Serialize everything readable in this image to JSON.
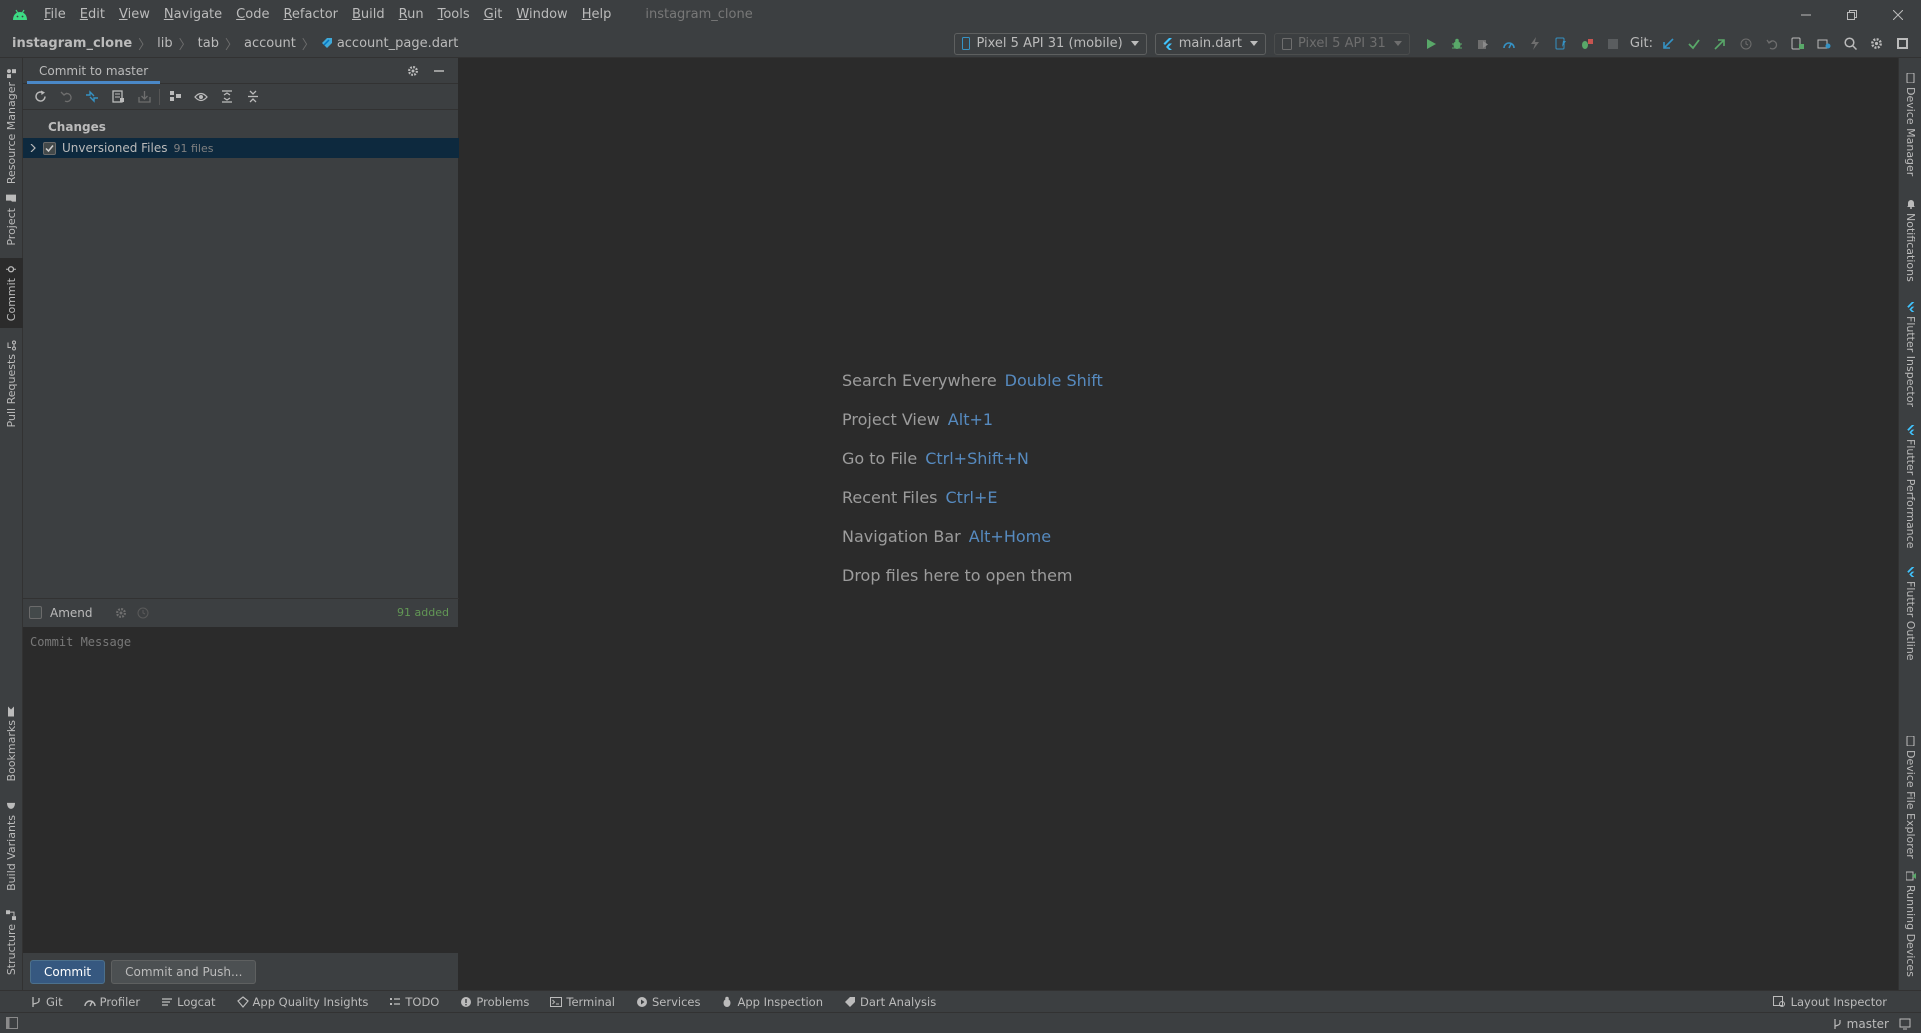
{
  "colors": {
    "background": "#2b2b2b",
    "chrome": "#3c3f41",
    "accent": "#4a88c7",
    "selection": "#0d293e",
    "run_green": "#59a869",
    "git_blue": "#3592c4",
    "added_green": "#629755",
    "shortcut_blue": "#5e9bd9",
    "android_green": "#3ddc84"
  },
  "window": {
    "title": "instagram_clone",
    "app_icon": "android-studio-icon",
    "menu": [
      {
        "label": "File",
        "mnemonic": "F",
        "rest": "ile"
      },
      {
        "label": "Edit",
        "mnemonic": "E",
        "rest": "dit"
      },
      {
        "label": "View",
        "mnemonic": "V",
        "rest": "iew"
      },
      {
        "label": "Navigate",
        "mnemonic": "N",
        "rest": "avigate"
      },
      {
        "label": "Code",
        "mnemonic": "C",
        "rest": "ode"
      },
      {
        "label": "Refactor",
        "mnemonic": "R",
        "rest": "efactor"
      },
      {
        "label": "Build",
        "mnemonic": "B",
        "rest": "uild"
      },
      {
        "label": "Run",
        "mnemonic": "R",
        "rest": "un"
      },
      {
        "label": "Tools",
        "mnemonic": "T",
        "rest": "ools"
      },
      {
        "label": "Git",
        "mnemonic": "G",
        "rest": "it"
      },
      {
        "label": "Window",
        "mnemonic": "W",
        "rest": "indow"
      },
      {
        "label": "Help",
        "mnemonic": "H",
        "rest": "elp"
      }
    ]
  },
  "breadcrumbs": {
    "project": "instagram_clone",
    "items": [
      "lib",
      "tab",
      "account"
    ],
    "file": "account_page.dart"
  },
  "toolbar": {
    "device_selector": "Pixel 5 API 31 (mobile)",
    "run_config": "main.dart",
    "secondary_device": "Pixel 5 API 31",
    "git_label": "Git:"
  },
  "left_stripe": {
    "top": [
      "Resource Manager",
      "Project",
      "Commit",
      "Pull Requests"
    ],
    "bottom": [
      "Bookmarks",
      "Build Variants",
      "Structure"
    ]
  },
  "right_stripe": {
    "top": [
      "Device Manager",
      "Notifications",
      "Flutter Inspector",
      "Flutter Performance",
      "Flutter Outline"
    ],
    "bottom": [
      "Device File Explorer",
      "Running Devices"
    ]
  },
  "commit_panel": {
    "tab_title": "Commit to master",
    "changes_header": "Changes",
    "tree_item_label": "Unversioned Files",
    "tree_item_count": "91 files",
    "amend_label": "Amend",
    "added_summary": "91 added",
    "message_placeholder": "Commit Message",
    "commit_button": "Commit",
    "commit_push_button": "Commit and Push..."
  },
  "editor_hints": [
    {
      "label": "Search Everywhere",
      "shortcut": "Double Shift"
    },
    {
      "label": "Project View",
      "shortcut": "Alt+1"
    },
    {
      "label": "Go to File",
      "shortcut": "Ctrl+Shift+N"
    },
    {
      "label": "Recent Files",
      "shortcut": "Ctrl+E"
    },
    {
      "label": "Navigation Bar",
      "shortcut": "Alt+Home"
    },
    {
      "label": "Drop files here to open them",
      "shortcut": ""
    }
  ],
  "bottom_tools": [
    "Git",
    "Profiler",
    "Logcat",
    "App Quality Insights",
    "TODO",
    "Problems",
    "Terminal",
    "Services",
    "App Inspection",
    "Dart Analysis"
  ],
  "bottom_right_tool": "Layout Inspector",
  "status": {
    "branch": "master"
  }
}
